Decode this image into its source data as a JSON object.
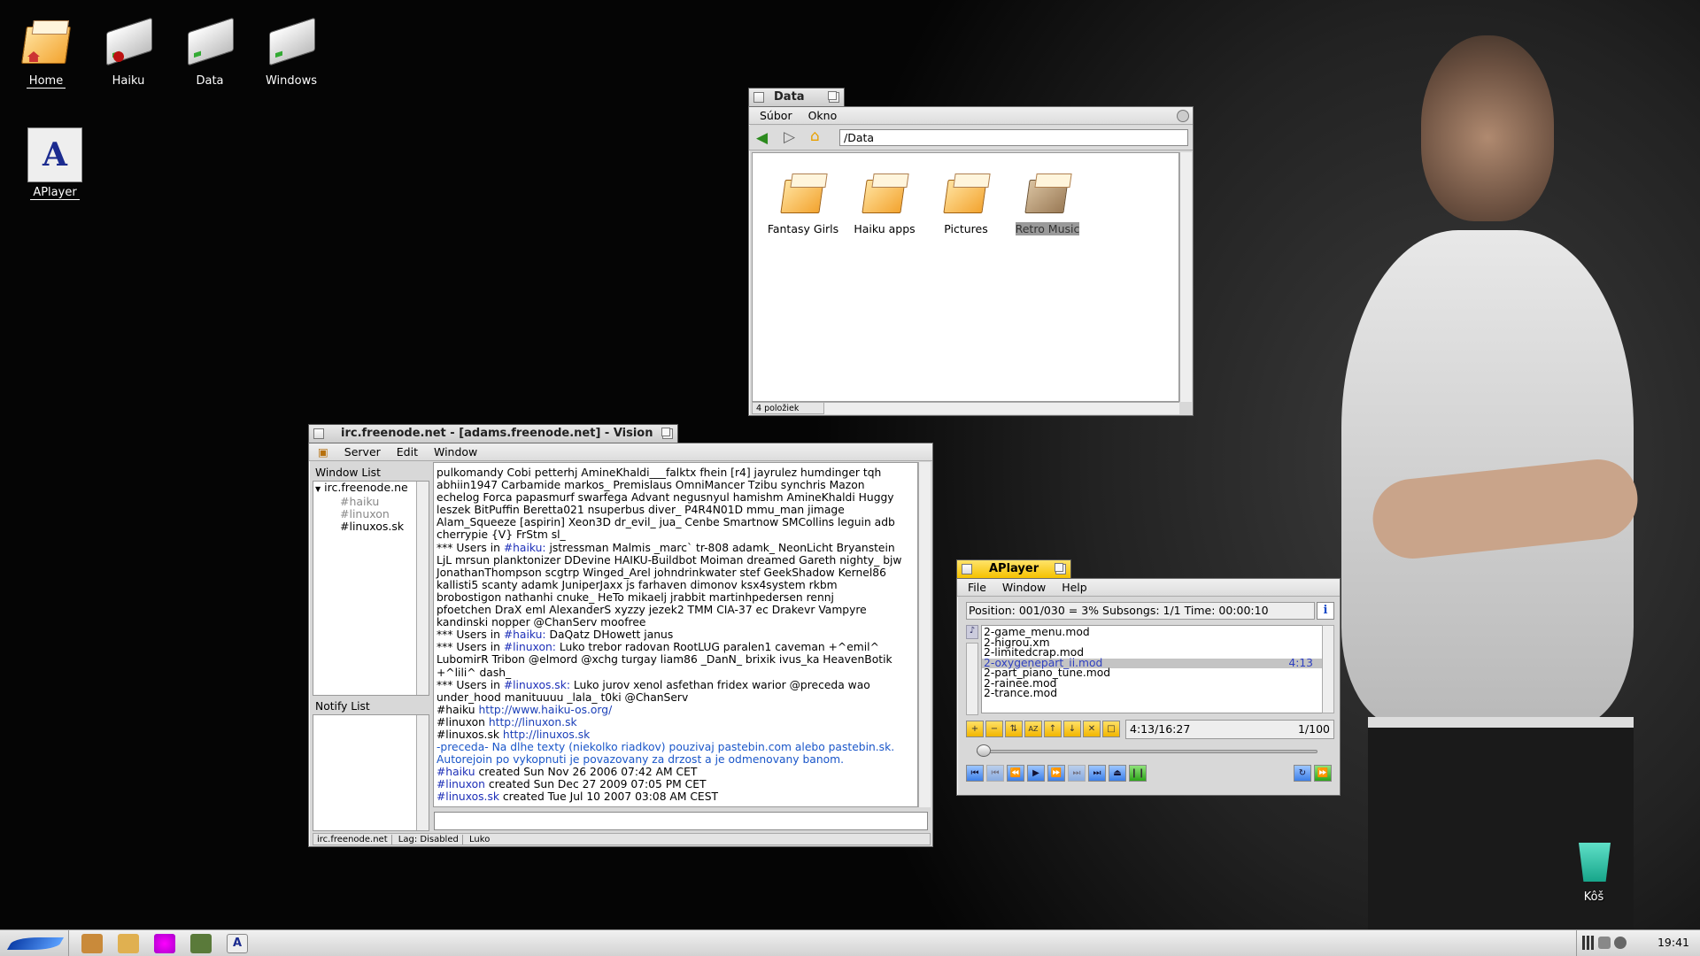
{
  "desktop": {
    "icons": [
      {
        "label": "Home",
        "icon": "home-folder-icon"
      },
      {
        "label": "Haiku",
        "icon": "haiku-disk-icon"
      },
      {
        "label": "Data",
        "icon": "data-disk-icon"
      },
      {
        "label": "Windows",
        "icon": "windows-disk-icon"
      },
      {
        "label": "APlayer",
        "icon": "aplayer-icon"
      }
    ],
    "trash_label": "Kôš"
  },
  "tracker": {
    "title": "Data",
    "menu": [
      "Súbor",
      "Okno"
    ],
    "path": "/Data",
    "items": [
      {
        "label": "Fantasy Girls",
        "selected": false
      },
      {
        "label": "Haiku apps",
        "selected": false
      },
      {
        "label": "Pictures",
        "selected": false
      },
      {
        "label": "Retro Music",
        "selected": true
      }
    ],
    "status": "4 položiek"
  },
  "vision": {
    "title": "irc.freenode.net - [adams.freenode.net] - Vision",
    "menu": [
      "Server",
      "Edit",
      "Window"
    ],
    "window_list_label": "Window List",
    "server": "irc.freenode.ne",
    "channels": [
      "#haiku",
      "#linuxon",
      "#linuxos.sk"
    ],
    "notify_list_label": "Notify List",
    "lines": [
      {
        "t": " pulkomandy Cobi petterhj AmineKhaldi___falktx fhein [r4] jayrulez humdinger tqh"
      },
      {
        "t": " abhiin1947 Carbamide markos_ Premislaus OmniMancer Tzibu synchris Mazon"
      },
      {
        "t": " echelog Forca papasmurf swarfega Advant negusnyul hamishm AmineKhaldi Huggy"
      },
      {
        "t": " leszek BitPuffin Beretta021 nsuperbus diver_ P4R4N01D mmu_man jimage"
      },
      {
        "t": " Alam_Squeeze [aspirin] Xeon3D dr_evil_ jua_ Cenbe Smartnow SMCollins leguin adb"
      },
      {
        "t": " cherrypie {V} FrStm sl_"
      },
      {
        "p": "*** Users in ",
        "c": "#haiku:",
        "t": " jstressman Malmis _marc` tr-808 adamk_ NeonLicht Bryanstein"
      },
      {
        "t": " LjL mrsun planktonizer DDevine HAIKU-Buildbot Moiman dreamed Gareth nighty_ bjw"
      },
      {
        "t": " JonathanThompson scgtrp Winged_Arel johndrinkwater stef GeekShadow Kernel86"
      },
      {
        "t": " kallisti5 scanty adamk JuniperJaxx js farhaven dimonov ksx4system rkbm"
      },
      {
        "t": " brobostigon nathanhi cnuke_ HeTo mikaelj jrabbit martinhpedersen rennj"
      },
      {
        "t": " pfoetchen DraX eml AlexanderS xyzzy jezek2 TMM CIA-37 ec Drakevr Vampyre"
      },
      {
        "t": " kandinski nopper @ChanServ moofree"
      },
      {
        "p": "*** Users in ",
        "c": "#haiku:",
        "t": " DaQatz DHowett janus"
      },
      {
        "p": "*** Users in ",
        "c": "#linuxon:",
        "t": " Luko trebor radovan RootLUG paralen1 caveman +^emil^"
      },
      {
        "t": " LubomirR Tribon @elmord @xchg turgay liam86 _DanN_ brixik ivus_ka HeavenBotik"
      },
      {
        "t": " +^lili^ dash_"
      },
      {
        "p": "*** Users in ",
        "c": "#linuxos.sk:",
        "t": " Luko jurov xenol asfethan fridex warior @preceda wao"
      },
      {
        "t": " under_hood manituuuu _lala_ t0ki @ChanServ"
      },
      {
        "p": "#haiku ",
        "l": "http://www.haiku-os.org/"
      },
      {
        "p": "#linuxon ",
        "l": "http://linuxon.sk"
      },
      {
        "p": "#linuxos.sk ",
        "l": "http://linuxos.sk"
      },
      {
        "b": "-preceda- Na dlhe texty (niekolko riadkov) pouzivaj pastebin.com alebo pastebin.sk."
      },
      {
        "b": " Autorejoin po vykopnuti je povazovany za drzost a je odmenovany banom."
      },
      {
        "c": "#haiku",
        "t": " created Sun Nov 26 2006 07:42 AM CET"
      },
      {
        "c": "#linuxon",
        "t": " created Sun Dec 27 2009 07:05 PM CET"
      },
      {
        "c": "#linuxos.sk",
        "t": " created Tue Jul 10 2007 03:08 AM CEST"
      }
    ],
    "input_value": "",
    "status": [
      "irc.freenode.net",
      "Lag: Disabled",
      "Luko"
    ]
  },
  "aplayer": {
    "title": "APlayer",
    "menu": [
      "File",
      "Window",
      "Help"
    ],
    "position": "Position: 001/030 =  3% Subsongs: 1/1 Time: 00:00:10",
    "playlist": [
      {
        "name": "2-game_menu.mod",
        "time": "",
        "selected": false
      },
      {
        "name": "2-higrou.xm",
        "time": "",
        "selected": false
      },
      {
        "name": "2-limitedcrap.mod",
        "time": "",
        "selected": false
      },
      {
        "name": "2-oxygenepart_ii.mod",
        "time": "4:13",
        "selected": true
      },
      {
        "name": "2-part_piano_tune.mod",
        "time": "",
        "selected": false
      },
      {
        "name": "2-rainee.mod",
        "time": "",
        "selected": false
      },
      {
        "name": "2-trance.mod",
        "time": "",
        "selected": false
      }
    ],
    "time_display": "4:13/16:27",
    "count_display": "1/100",
    "seek_position_fraction": 0.01
  },
  "taskbar": {
    "clock": "19:41"
  }
}
